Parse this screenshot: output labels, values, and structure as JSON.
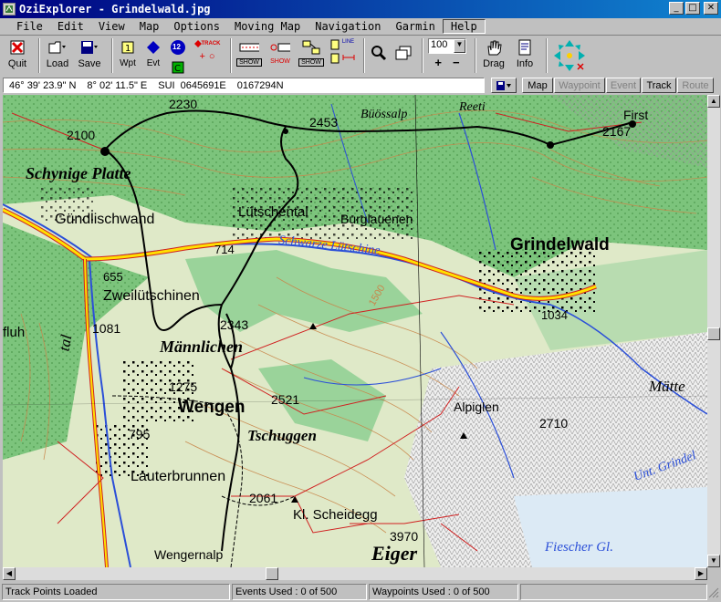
{
  "window": {
    "title": "OziExplorer - Grindelwald.jpg",
    "controls": [
      "_",
      "□",
      "✕"
    ]
  },
  "menu": [
    "File",
    "Edit",
    "View",
    "Map",
    "Options",
    "Moving Map",
    "Navigation",
    "Garmin",
    "Help"
  ],
  "toolbar": {
    "quit": "Quit",
    "load": "Load",
    "save": "Save",
    "wpt": "Wpt",
    "evt": "Evt",
    "track_small": "TRACK",
    "show1": "SHOW",
    "show2": "SHOW",
    "show3": "SHOW",
    "line": "LINE",
    "zoom_value": "100",
    "zoom_in": "+",
    "zoom_out": "−",
    "drag": "Drag",
    "info": "Info",
    "number12": "12"
  },
  "coords": {
    "lat": "46° 39' 23.9\" N",
    "lon": "8° 02' 11.5\" E",
    "grid": "SUI",
    "easting": "0645691E",
    "northing": "0167294N"
  },
  "modes": {
    "map": "Map",
    "waypoint": "Waypoint",
    "event": "Event",
    "track": "Track",
    "route": "Route"
  },
  "map_labels": {
    "schynige": "Schynige Platte",
    "e2100": "2100",
    "e2230": "2230",
    "e2453": "2453",
    "buossalp": "Büössalp",
    "reeti": "Reeti",
    "first": "First",
    "e2167": "2167",
    "gundlischwand": "Gündlischwand",
    "lutschental": "Lütschental",
    "burglauenen": "Burglauenen",
    "schwarze": "Schwarze Lütschine",
    "grindelwald": "Grindelwald",
    "e714": "714",
    "e655": "655",
    "zweilutschinen": "Zweilütschinen",
    "e1500": "1500",
    "e1034": "1034",
    "fluh": "fluh",
    "e1081": "1081",
    "e2343": "2343",
    "mannlichen": "Männlichen",
    "e1275": "1275",
    "wengen": "Wengen",
    "e2521": "2521",
    "tschuggen": "Tschuggen",
    "alpiglen": "Alpiglen",
    "e2710": "2710",
    "matten": "Mätte",
    "e795": "795",
    "lauterbrunnen": "Lauterbrunnen",
    "tal": "tal",
    "e2061": "2061",
    "klscheidegg": "Kl. Scheidegg",
    "e3970": "3970",
    "eiger": "Eiger",
    "wengernalp": "Wengernalp",
    "fiescher": "Fiescher Gl.",
    "untgrindel": "Unt. Grindel"
  },
  "status": {
    "message": "Track Points Loaded",
    "events": "Events Used : 0 of 500",
    "waypoints": "Waypoints Used : 0 of 500"
  },
  "colors": {
    "title_start": "#000080",
    "title_end": "#1084d0",
    "chrome": "#c0c0c0"
  }
}
